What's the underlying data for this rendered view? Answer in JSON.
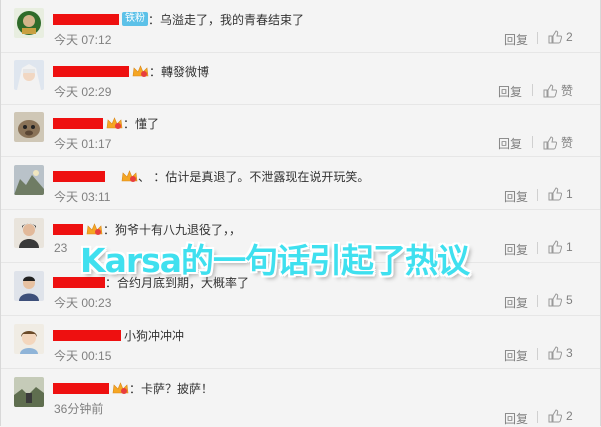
{
  "comments": [
    {
      "text": "：乌溢走了，我的青春结束了",
      "badge": "铁粉",
      "time": "今天 07:12",
      "reply": "回复",
      "likes": "2"
    },
    {
      "text": "：轉發微博",
      "time": "今天 02:29",
      "reply": "回复",
      "likes": "赞"
    },
    {
      "text": "：懂了",
      "time": "今天 01:17",
      "reply": "回复",
      "likes": "赞"
    },
    {
      "text": "、 ：估计是真退了。不泄露现在说开玩笑。",
      "time": "今天 03:11",
      "reply": "回复",
      "likes": "1"
    },
    {
      "text": "：狗爷十有八九退役了，，",
      "time": "23",
      "reply": "回复",
      "likes": "1"
    },
    {
      "text": "：合约月底到期，大概率了",
      "time": "今天 00:23",
      "reply": "回复",
      "likes": "5"
    },
    {
      "text": "小狗冲冲冲",
      "time": "今天 00:15",
      "reply": "回复",
      "likes": "3"
    },
    {
      "text": "：卡萨？披萨！",
      "time": "36分钟前",
      "reply": "回复",
      "likes": "2"
    }
  ],
  "overlay_caption": "Karsa的一句话引起了热议",
  "colors": {
    "caption": "#3fe0ef",
    "redaction": "#ee1010",
    "badge": "#5cc1e8"
  }
}
